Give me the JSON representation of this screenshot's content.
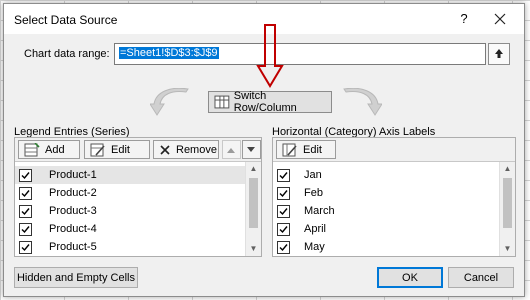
{
  "dialog": {
    "title": "Select Data Source",
    "help_label": "?"
  },
  "range": {
    "label": "Chart data range:",
    "value": "=Sheet1!$D$3:$J$9"
  },
  "switch_button": {
    "label": "Switch Row/Column"
  },
  "legend": {
    "header": "Legend Entries (Series)",
    "add_label": "Add",
    "edit_label": "Edit",
    "remove_label": "Remove",
    "items": [
      {
        "label": "Product-1",
        "checked": true,
        "selected": true
      },
      {
        "label": "Product-2",
        "checked": true
      },
      {
        "label": "Product-3",
        "checked": true
      },
      {
        "label": "Product-4",
        "checked": true
      },
      {
        "label": "Product-5",
        "checked": true
      }
    ]
  },
  "axis": {
    "header": "Horizontal (Category) Axis Labels",
    "edit_label": "Edit",
    "items": [
      {
        "label": "Jan",
        "checked": true
      },
      {
        "label": "Feb",
        "checked": true
      },
      {
        "label": "March",
        "checked": true
      },
      {
        "label": "April",
        "checked": true
      },
      {
        "label": "May",
        "checked": true
      }
    ]
  },
  "footer": {
    "hidden_cells_label": "Hidden and Empty Cells",
    "ok_label": "OK",
    "cancel_label": "Cancel"
  },
  "colors": {
    "annotation_arrow": "#c00000",
    "selection": "#0078d7",
    "default_button_border": "#0078d7"
  },
  "icons": {
    "close": "close-icon",
    "collapse": "collapse-dialog-icon",
    "switch": "switch-row-column-icon",
    "add": "add-series-icon",
    "edit": "edit-series-icon",
    "remove": "remove-series-icon",
    "move_up": "move-up-icon",
    "move_down": "move-down-icon",
    "annotation": "red-down-arrow-icon"
  }
}
